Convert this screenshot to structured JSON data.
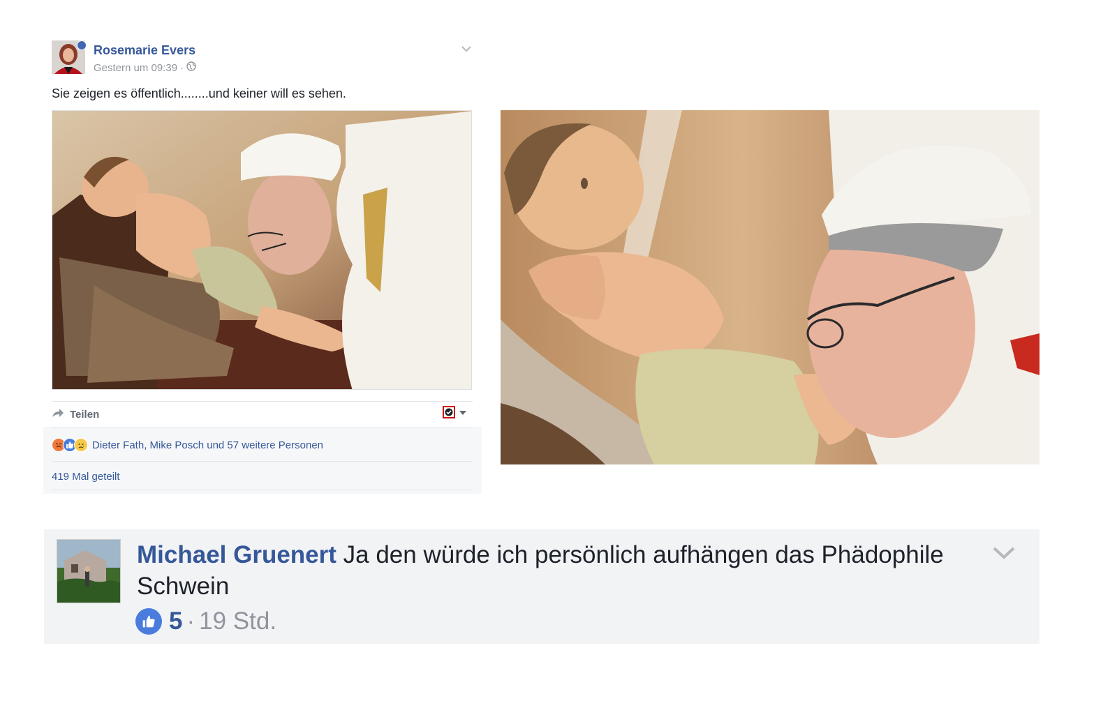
{
  "post": {
    "author": "Rosemarie Evers",
    "timestamp": "Gestern um 09:39",
    "separator": "·",
    "privacy_icon": "globe-icon",
    "text": "Sie zeigen es öffentlich........und keiner will es sehen.",
    "share_label": "Teilen",
    "reactions": {
      "icons": [
        "angry-reaction-icon",
        "like-reaction-icon",
        "sad-reaction-icon"
      ],
      "names_text": "Dieter Fath, Mike Posch und 57 weitere Personen"
    },
    "shares_text": "419 Mal geteilt"
  },
  "comment": {
    "author": "Michael Gruenert",
    "text": " Ja den würde ich persönlich aufhängen das Phädophile Schwein",
    "like_count": "5",
    "separator": "·",
    "time": "19 Std."
  },
  "colors": {
    "link_blue": "#365899",
    "like_blue": "#4a7cde",
    "meta_gray": "#90949c",
    "comment_bg": "#f2f3f5",
    "footer_bg": "#f6f7f9"
  }
}
